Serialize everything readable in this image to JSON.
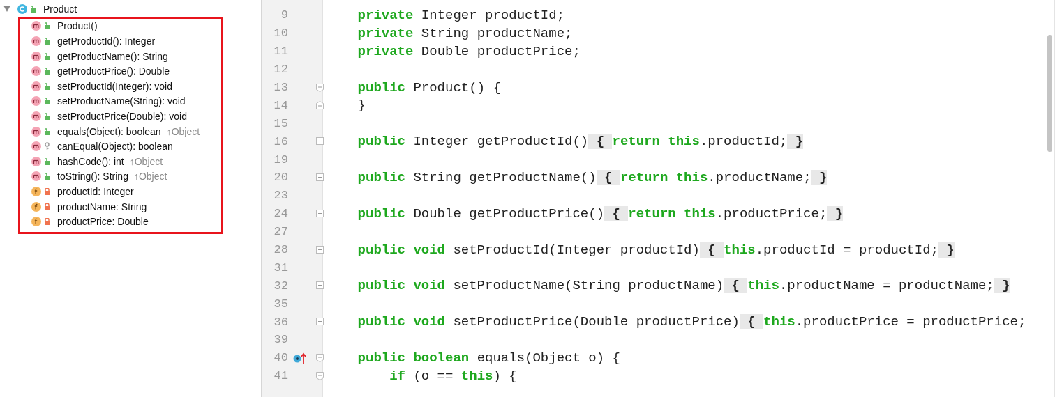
{
  "structure": {
    "root": {
      "label": "Product",
      "kind": "public-class",
      "expanded": true,
      "highlighted": true,
      "children": [
        {
          "label": "Product()",
          "kind": "public-method"
        },
        {
          "label": "getProductId(): Integer",
          "kind": "public-method"
        },
        {
          "label": "getProductName(): String",
          "kind": "public-method"
        },
        {
          "label": "getProductPrice(): Double",
          "kind": "public-method"
        },
        {
          "label": "setProductId(Integer): void",
          "kind": "public-method"
        },
        {
          "label": "setProductName(String): void",
          "kind": "public-method"
        },
        {
          "label": "setProductPrice(Double): void",
          "kind": "public-method"
        },
        {
          "label": "equals(Object): boolean",
          "kind": "public-method",
          "inherited": "↑Object"
        },
        {
          "label": "canEqual(Object): boolean",
          "kind": "protected-method"
        },
        {
          "label": "hashCode(): int",
          "kind": "public-method",
          "inherited": "↑Object"
        },
        {
          "label": "toString(): String",
          "kind": "public-method",
          "inherited": "↑Object"
        },
        {
          "label": "productId: Integer",
          "kind": "private-field"
        },
        {
          "label": "productName: String",
          "kind": "private-field"
        },
        {
          "label": "productPrice: Double",
          "kind": "private-field"
        }
      ]
    }
  },
  "editor": {
    "lines": [
      {
        "number": "9",
        "tokens": [
          {
            "kind": "kw",
            "text": "    private"
          },
          {
            "kind": "text",
            "text": " Integer productId;"
          }
        ]
      },
      {
        "number": "10",
        "tokens": [
          {
            "kind": "kw",
            "text": "    private"
          },
          {
            "kind": "text",
            "text": " String productName;"
          }
        ]
      },
      {
        "number": "11",
        "tokens": [
          {
            "kind": "kw",
            "text": "    private"
          },
          {
            "kind": "text",
            "text": " Double productPrice;"
          }
        ]
      },
      {
        "number": "12"
      },
      {
        "number": "13",
        "fold": {
          "kind": "start"
        },
        "tokens": [
          {
            "kind": "kw",
            "text": "    public"
          },
          {
            "kind": "text",
            "text": " Product() {"
          }
        ]
      },
      {
        "number": "14",
        "fold": {
          "kind": "end"
        },
        "tokens": [
          {
            "kind": "text",
            "text": "    }"
          }
        ]
      },
      {
        "number": "15"
      },
      {
        "number": "16",
        "fold": {
          "kind": "collapsed"
        },
        "tokens": [
          {
            "kind": "kw",
            "text": "    public"
          },
          {
            "kind": "text",
            "text": " Integer getProductId()"
          },
          {
            "kind": "fold",
            "text": " { "
          },
          {
            "kind": "kw",
            "text": "return this"
          },
          {
            "kind": "text",
            "text": ".productId;"
          },
          {
            "kind": "fold",
            "text": " }"
          }
        ]
      },
      {
        "number": "19"
      },
      {
        "number": "20",
        "fold": {
          "kind": "collapsed"
        },
        "tokens": [
          {
            "kind": "kw",
            "text": "    public"
          },
          {
            "kind": "text",
            "text": " String getProductName()"
          },
          {
            "kind": "fold",
            "text": " { "
          },
          {
            "kind": "kw",
            "text": "return this"
          },
          {
            "kind": "text",
            "text": ".productName;"
          },
          {
            "kind": "fold",
            "text": " }"
          }
        ]
      },
      {
        "number": "23"
      },
      {
        "number": "24",
        "fold": {
          "kind": "collapsed"
        },
        "tokens": [
          {
            "kind": "kw",
            "text": "    public"
          },
          {
            "kind": "text",
            "text": " Double getProductPrice()"
          },
          {
            "kind": "fold",
            "text": " { "
          },
          {
            "kind": "kw",
            "text": "return this"
          },
          {
            "kind": "text",
            "text": ".productPrice;"
          },
          {
            "kind": "fold",
            "text": " }"
          }
        ]
      },
      {
        "number": "27"
      },
      {
        "number": "28",
        "fold": {
          "kind": "collapsed"
        },
        "tokens": [
          {
            "kind": "kw",
            "text": "    public void"
          },
          {
            "kind": "text",
            "text": " setProductId(Integer productId)"
          },
          {
            "kind": "fold",
            "text": " { "
          },
          {
            "kind": "kw",
            "text": "this"
          },
          {
            "kind": "text",
            "text": ".productId = productId;"
          },
          {
            "kind": "fold",
            "text": " }"
          }
        ]
      },
      {
        "number": "31"
      },
      {
        "number": "32",
        "fold": {
          "kind": "collapsed"
        },
        "tokens": [
          {
            "kind": "kw",
            "text": "    public void"
          },
          {
            "kind": "text",
            "text": " setProductName(String productName)"
          },
          {
            "kind": "fold",
            "text": " { "
          },
          {
            "kind": "kw",
            "text": "this"
          },
          {
            "kind": "text",
            "text": ".productName = productName;"
          },
          {
            "kind": "fold",
            "text": " }"
          }
        ]
      },
      {
        "number": "35"
      },
      {
        "number": "36",
        "fold": {
          "kind": "collapsed"
        },
        "tokens": [
          {
            "kind": "kw",
            "text": "    public void"
          },
          {
            "kind": "text",
            "text": " setProductPrice(Double productPrice)"
          },
          {
            "kind": "fold",
            "text": " { "
          },
          {
            "kind": "kw",
            "text": "this"
          },
          {
            "kind": "text",
            "text": ".productPrice = productPrice;"
          }
        ]
      },
      {
        "number": "39"
      },
      {
        "number": "40",
        "fold": {
          "kind": "start"
        },
        "overrides": true,
        "tokens": [
          {
            "kind": "kw",
            "text": "    public boolean"
          },
          {
            "kind": "text",
            "text": " equals(Object o) {"
          }
        ]
      },
      {
        "number": "41",
        "fold": {
          "kind": "start"
        },
        "tokens": [
          {
            "kind": "kw",
            "text": "        if"
          },
          {
            "kind": "text",
            "text": " (o == "
          },
          {
            "kind": "kw",
            "text": "this"
          },
          {
            "kind": "text",
            "text": ") {"
          }
        ]
      }
    ]
  }
}
